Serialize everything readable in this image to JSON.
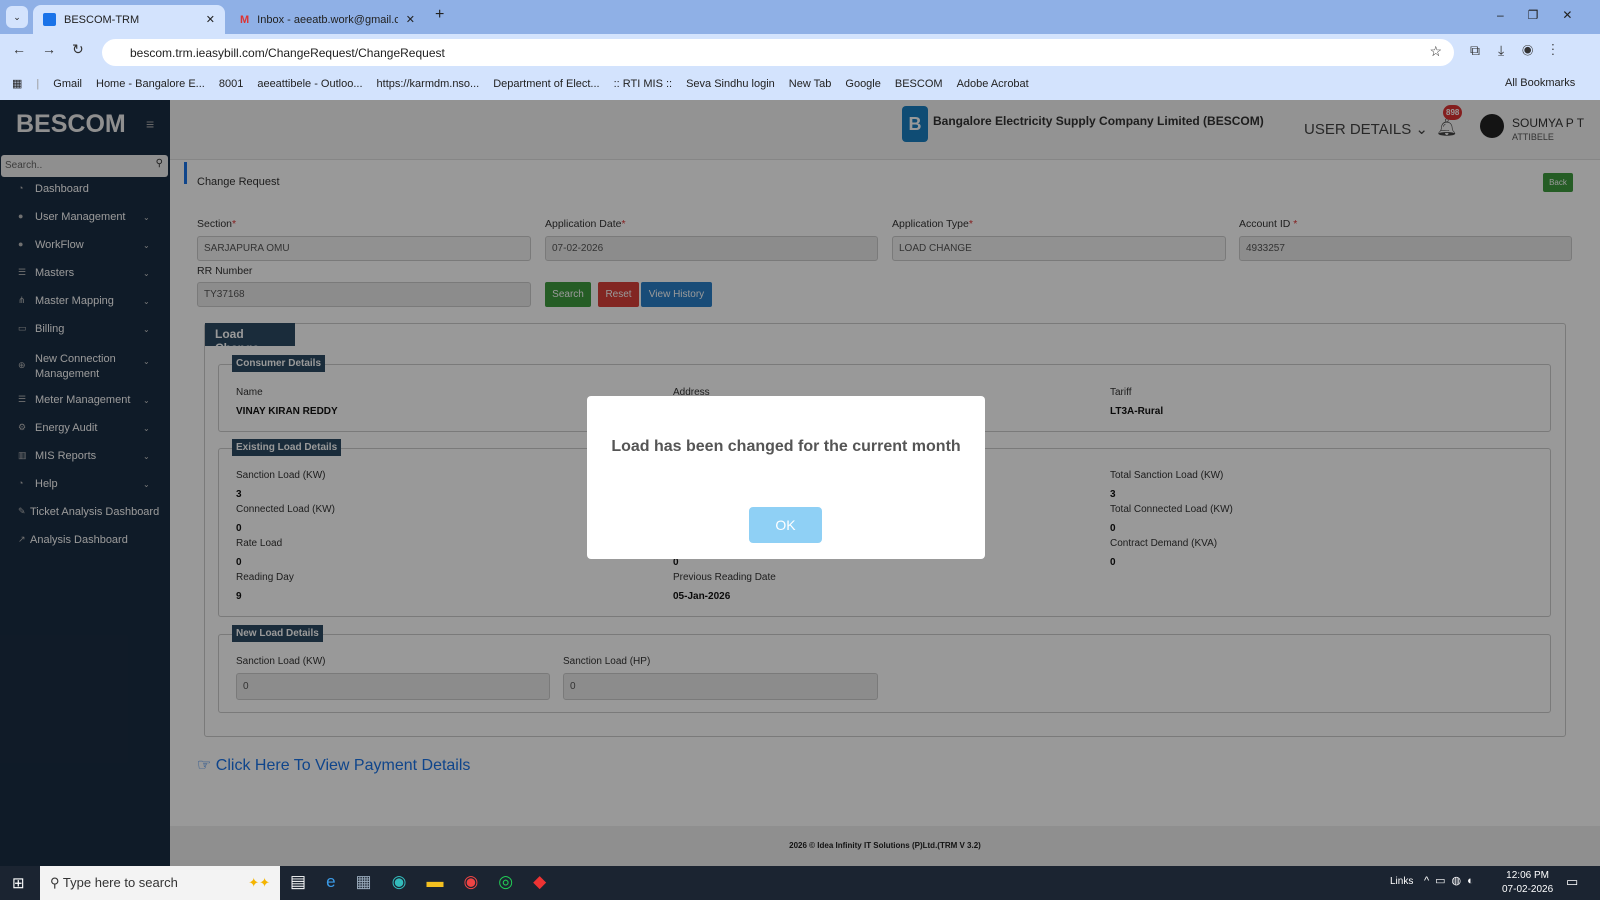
{
  "browser": {
    "tabs": [
      {
        "title": "BESCOM-TRM",
        "active": true
      },
      {
        "title": "Inbox - aeeatb.work@gmail.com",
        "active": false
      }
    ],
    "url": "bescom.trm.ieasybill.com/ChangeRequest/ChangeRequest",
    "bookmarks": [
      "Gmail",
      "Home - Bangalore E...",
      "8001",
      "aeeattibele - Outloo...",
      "https://karmdm.nso...",
      "Department of Elect...",
      ":: RTI MIS ::",
      "Seva Sindhu login",
      "New Tab",
      "Google",
      "BESCOM",
      "Adobe Acrobat"
    ],
    "all_bookmarks": "All Bookmarks"
  },
  "sidebar": {
    "brand": "BESCOM",
    "search_placeholder": "Search..",
    "items": [
      {
        "label": "Dashboard",
        "icon": "dashboard-icon",
        "chev": false
      },
      {
        "label": "User Management",
        "icon": "user-icon",
        "chev": true
      },
      {
        "label": "WorkFlow",
        "icon": "user-icon",
        "chev": true
      },
      {
        "label": "Masters",
        "icon": "list-icon",
        "chev": true
      },
      {
        "label": "Master Mapping",
        "icon": "sitemap-icon",
        "chev": true
      },
      {
        "label": "Billing",
        "icon": "monitor-icon",
        "chev": true
      },
      {
        "label": "New Connection Management",
        "icon": "plus-circle-icon",
        "chev": true
      },
      {
        "label": "Meter Management",
        "icon": "list-icon",
        "chev": true
      },
      {
        "label": "Energy Audit",
        "icon": "cogs-icon",
        "chev": true
      },
      {
        "label": "MIS Reports",
        "icon": "bar-chart-icon",
        "chev": true
      },
      {
        "label": "Help",
        "icon": "help-icon",
        "chev": true
      },
      {
        "label": "Ticket Analysis Dashboard",
        "icon": "ticket-icon",
        "chev": false
      },
      {
        "label": "Analysis Dashboard",
        "icon": "line-chart-icon",
        "chev": false
      }
    ]
  },
  "header": {
    "company": "Bangalore Electricity Supply Company Limited (BESCOM)",
    "user_details": "USER DETAILS",
    "notifications": "898",
    "user_name": "SOUMYA P T",
    "user_location": "ATTIBELE"
  },
  "main": {
    "title": "Change Request",
    "back": "Back",
    "form": {
      "section_label": "Section",
      "section_value": "SARJAPURA OMU",
      "app_date_label": "Application Date",
      "app_date_value": "07-02-2026",
      "app_type_label": "Application Type",
      "app_type_value": "LOAD CHANGE",
      "account_label": "Account ID",
      "account_value": "4933257",
      "rr_label": "RR Number",
      "rr_value": "TY37168",
      "search": "Search",
      "reset": "Reset",
      "view_history": "View History"
    },
    "load_change": {
      "legend": "Load Change",
      "consumer": {
        "legend": "Consumer Details",
        "name_label": "Name",
        "name_value": "VINAY KIRAN REDDY",
        "address_label": "Address",
        "tariff_label": "Tariff",
        "tariff_value": "LT3A-Rural"
      },
      "existing": {
        "legend": "Existing Load Details",
        "sanction_label": "Sanction Load (KW)",
        "sanction_value": "3",
        "connected_label": "Connected Load (KW)",
        "connected_value": "0",
        "rate_label": "Rate Load",
        "rate_value": "0",
        "reading_day_label": "Reading Day",
        "reading_day_value": "9",
        "mid_value": "0",
        "prev_date_label": "Previous Reading Date",
        "prev_date_value": "05-Jan-2026",
        "total_sanction_label": "Total Sanction Load (KW)",
        "total_sanction_value": "3",
        "total_connected_label": "Total Connected Load (KW)",
        "total_connected_value": "0",
        "contract_label": "Contract Demand (KVA)",
        "contract_value": "0"
      },
      "new_load": {
        "legend": "New Load Details",
        "kw_label": "Sanction Load (KW)",
        "kw_value": "0",
        "hp_label": "Sanction Load (HP)",
        "hp_value": "0"
      }
    },
    "payment_link": "Click Here To View Payment Details",
    "footer": "2026 © Idea Infinity IT Solutions (P)Ltd.(TRM V 3.2)"
  },
  "modal": {
    "message": "Load has been changed for the current month",
    "ok": "OK"
  },
  "taskbar": {
    "search_placeholder": "Type here to search",
    "links": "Links",
    "time": "12:06 PM",
    "date": "07-02-2026"
  }
}
